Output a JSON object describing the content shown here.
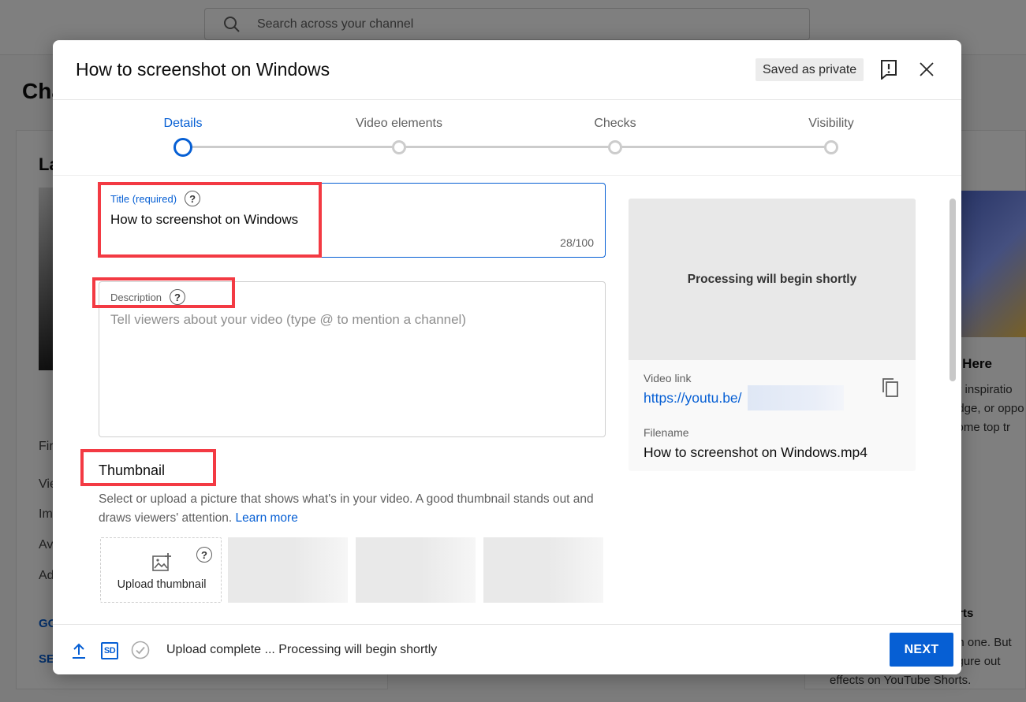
{
  "background": {
    "search_placeholder": "Search across your channel",
    "heading_fragment": "Cha",
    "left_card_heading_fragment": "La",
    "left_menu_fragments": [
      "Fir",
      "Vie",
      "Im",
      "Av",
      "Ad"
    ],
    "left_links": [
      "GO",
      "SE"
    ],
    "right_card_texts": [
      "s Here",
      "or inspiratio",
      "edge, or oppo",
      "some top tr",
      "orts",
      "an one. But",
      "figure out",
      "effects on YouTube Shorts."
    ]
  },
  "dialog": {
    "title": "How to screenshot on Windows",
    "saved_badge": "Saved as private"
  },
  "stepper": {
    "steps": [
      {
        "label": "Details",
        "active": true
      },
      {
        "label": "Video elements",
        "active": false
      },
      {
        "label": "Checks",
        "active": false
      },
      {
        "label": "Visibility",
        "active": false
      }
    ]
  },
  "form": {
    "title_label": "Title (required)",
    "title_value": "How to screenshot on Windows",
    "title_count": "28/100",
    "description_label": "Description",
    "description_placeholder": "Tell viewers about your video (type @ to mention a channel)",
    "help_glyph": "?",
    "thumbnail_heading": "Thumbnail",
    "thumbnail_desc": "Select or upload a picture that shows what's in your video. A good thumbnail stands out and draws viewers' attention.",
    "learn_more": "Learn more",
    "upload_thumbnail": "Upload thumbnail"
  },
  "preview": {
    "processing_text": "Processing will begin shortly",
    "video_link_label": "Video link",
    "video_link": "https://youtu.be/",
    "filename_label": "Filename",
    "filename": "How to screenshot on Windows.mp4"
  },
  "footer": {
    "sd_badge": "SD",
    "status": "Upload complete ... Processing will begin shortly",
    "next_label": "NEXT"
  },
  "colors": {
    "accent": "#065fd4",
    "annotation": "#f33a43"
  }
}
